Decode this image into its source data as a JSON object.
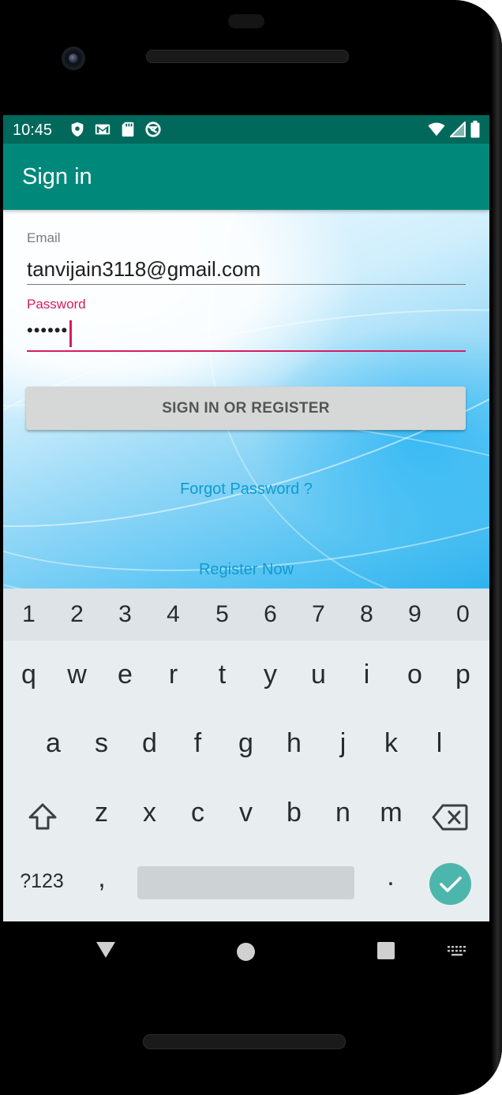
{
  "status_bar": {
    "time": "10:45",
    "left_icons": [
      "shield-icon",
      "gmail-icon",
      "sd-card-icon",
      "data-saver-icon"
    ],
    "right_icons": [
      "wifi-icon",
      "cell-signal-icon",
      "battery-icon"
    ]
  },
  "app_bar": {
    "title": "Sign in"
  },
  "form": {
    "email": {
      "label": "Email",
      "value": "tanvijain3118@gmail.com"
    },
    "password": {
      "label": "Password",
      "value": "••••••"
    },
    "submit_label": "SIGN IN OR REGISTER",
    "forgot_label": "Forgot Password ?",
    "register_label": "Register Now"
  },
  "keyboard": {
    "number_row": [
      "1",
      "2",
      "3",
      "4",
      "5",
      "6",
      "7",
      "8",
      "9",
      "0"
    ],
    "row1": [
      "q",
      "w",
      "e",
      "r",
      "t",
      "y",
      "u",
      "i",
      "o",
      "p"
    ],
    "row2": [
      "a",
      "s",
      "d",
      "f",
      "g",
      "h",
      "j",
      "k",
      "l"
    ],
    "row3": [
      "z",
      "x",
      "c",
      "v",
      "b",
      "n",
      "m"
    ],
    "symbols_label": "?123",
    "comma": ",",
    "period": "."
  },
  "colors": {
    "status_bar": "#00695c",
    "app_bar": "#00897b",
    "accent": "#d81b60",
    "link": "#0f9bd0",
    "enter_key": "#4db6ac"
  }
}
